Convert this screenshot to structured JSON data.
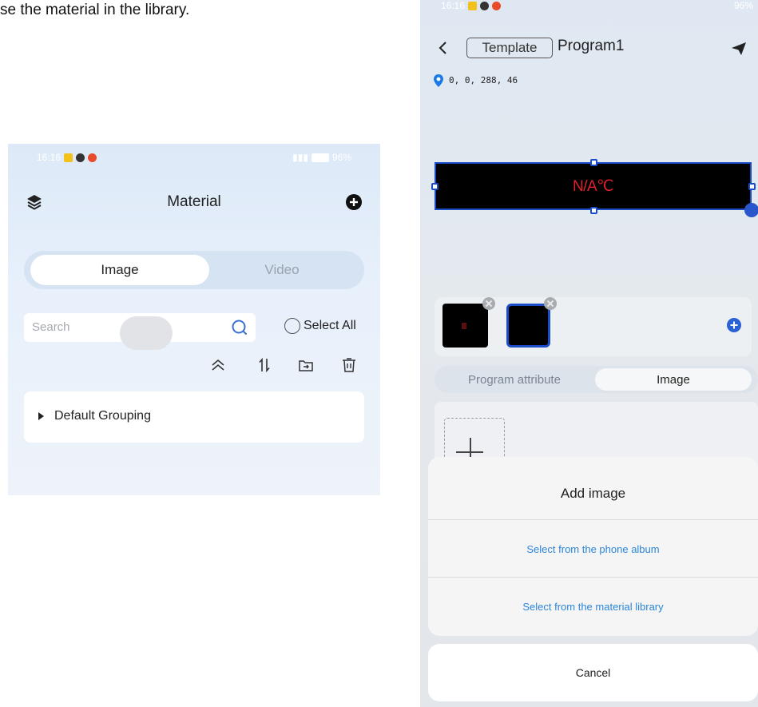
{
  "caption": "se the material in the library.",
  "material_screen": {
    "status_bar": {
      "time": "16:16",
      "battery": "96%"
    },
    "header": {
      "title": "Material"
    },
    "tabs": [
      {
        "label": "Image",
        "active": true
      },
      {
        "label": "Video",
        "active": false
      }
    ],
    "search": {
      "placeholder": "Search"
    },
    "select_all_label": "Select All",
    "groups": [
      {
        "label": "Default Grouping"
      }
    ]
  },
  "program_screen": {
    "status_bar": {
      "time": "16:16",
      "battery": "96%"
    },
    "header": {
      "template_label": "Template",
      "program_name": "Program1"
    },
    "coordinates": "0, 0, 288, 46",
    "led_preview_text": "N/A℃",
    "tabs": [
      {
        "label": "Program attribute",
        "active": false
      },
      {
        "label": "Image",
        "active": true
      }
    ],
    "add_image_sheet": {
      "title": "Add image",
      "options": [
        {
          "label": "Select from the phone album"
        },
        {
          "label": "Select from the material library"
        }
      ],
      "cancel_label": "Cancel"
    }
  },
  "colors": {
    "accent_blue": "#1a4dc7",
    "led_text_red": "#e0202a",
    "link_blue": "#2c86d8"
  }
}
